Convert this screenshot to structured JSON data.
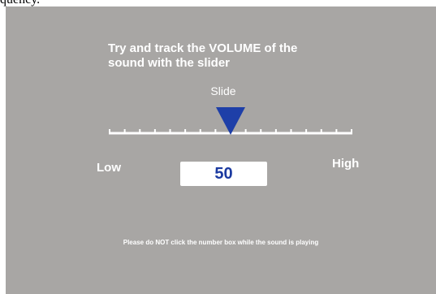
{
  "header_cut_text": "quency.",
  "instructions": "Try and track the VOLUME of the sound with the slider",
  "slider": {
    "label": "Slide",
    "min_label": "Low",
    "max_label": "High",
    "value": "50",
    "value_fraction": 0.5,
    "tick_count": 17
  },
  "warning": "Please do NOT click the number box while the sound is playing",
  "colors": {
    "panel": "#a8a6a4",
    "thumb": "#1e3fa8",
    "value_text": "#1b3aa0"
  }
}
